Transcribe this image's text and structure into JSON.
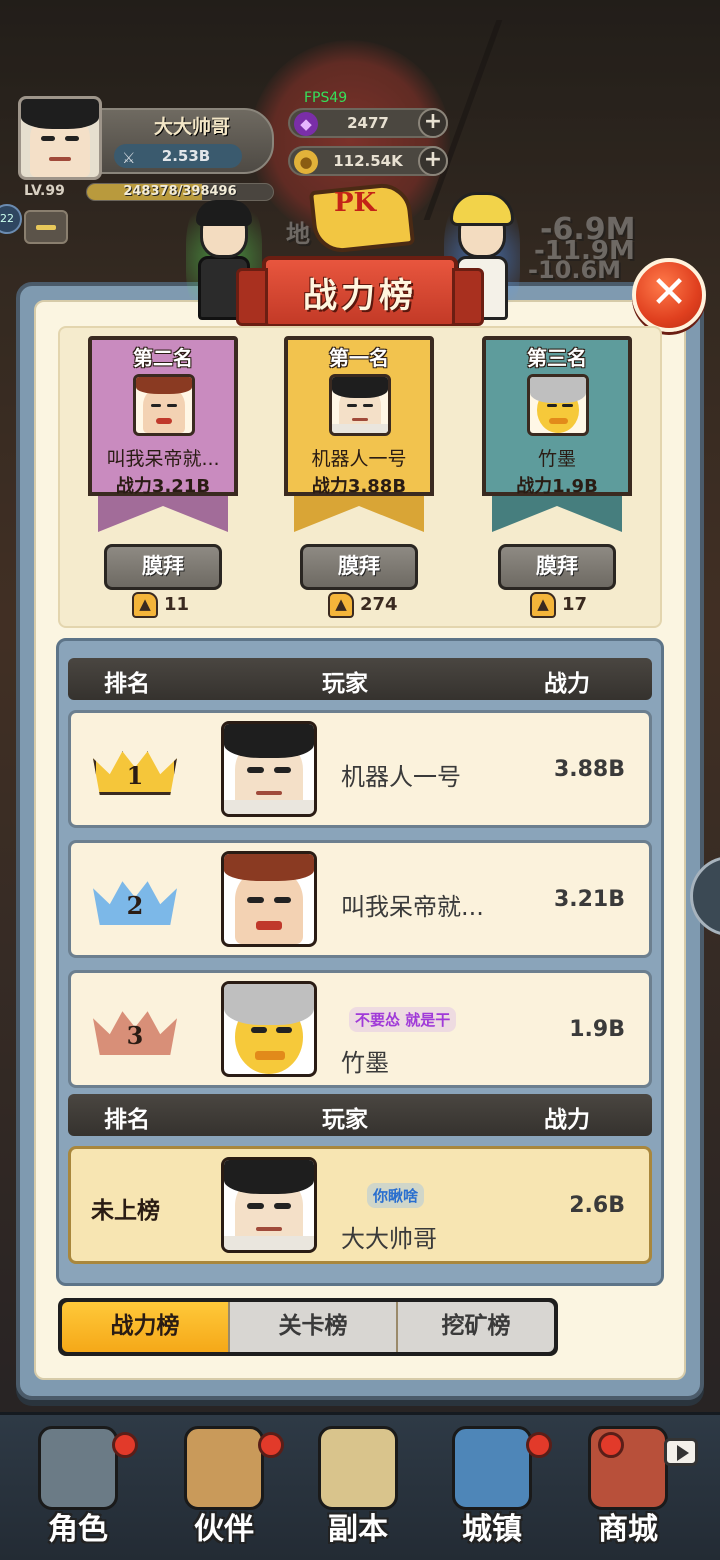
{
  "hud": {
    "player_name": "大大帅哥",
    "player_power": "2.53B",
    "level": "LV.99",
    "xp_text": "248378/398496",
    "xp_fraction": 0.62,
    "fps": "FPS49",
    "gems": "2477",
    "coins": "112.54K",
    "side_badge": "22",
    "bg_texts": [
      "地",
      "-6.9M",
      "-11.9M",
      "-10.6M"
    ]
  },
  "panel": {
    "title": "战力榜",
    "pk_text": "PK",
    "close_symbol": "✕"
  },
  "podium": [
    {
      "rank_label": "第二名",
      "name": "叫我呆帝就...",
      "power": "战力3.21B",
      "button": "膜拜",
      "likes": "11",
      "color": "#c98bbf",
      "tail": "#a26c99"
    },
    {
      "rank_label": "第一名",
      "name": "机器人一号",
      "power": "战力3.88B",
      "button": "膜拜",
      "likes": "274",
      "color": "#f2c34e",
      "tail": "#d9a536"
    },
    {
      "rank_label": "第三名",
      "name": "竹墨",
      "power": "战力1.9B",
      "button": "膜拜",
      "likes": "17",
      "color": "#5e9c9c",
      "tail": "#467e7e"
    }
  ],
  "list": {
    "headers": {
      "rank": "排名",
      "player": "玩家",
      "power": "战力"
    },
    "rows": [
      {
        "rank": "1",
        "name": "机器人一号",
        "power": "3.88B",
        "crown_color": "#f5c63a"
      },
      {
        "rank": "2",
        "name": "叫我呆帝就...",
        "power": "3.21B",
        "crown_color": "#7cb8e8"
      },
      {
        "rank": "3",
        "name": "竹墨",
        "power": "1.9B",
        "crown_color": "#d88f78",
        "title_badge": "不要怂 就是干"
      }
    ],
    "mine": {
      "rank": "未上榜",
      "name": "大大帅哥",
      "power": "2.6B",
      "title_badge": "你瞅啥"
    }
  },
  "tabs": [
    {
      "label": "战力榜",
      "active": true
    },
    {
      "label": "关卡榜",
      "active": false
    },
    {
      "label": "挖矿榜",
      "active": false
    }
  ],
  "bottom_nav": [
    {
      "label": "角色",
      "icon": "character-icon"
    },
    {
      "label": "伙伴",
      "icon": "partner-icon"
    },
    {
      "label": "副本",
      "icon": "dungeon-scroll-icon"
    },
    {
      "label": "城镇",
      "icon": "town-icon"
    },
    {
      "label": "商城",
      "icon": "shop-icon"
    }
  ],
  "colors": {
    "accent_active_tab": "#f5a818",
    "close_button": "#e0401f",
    "title_banner": "#c33a27"
  }
}
